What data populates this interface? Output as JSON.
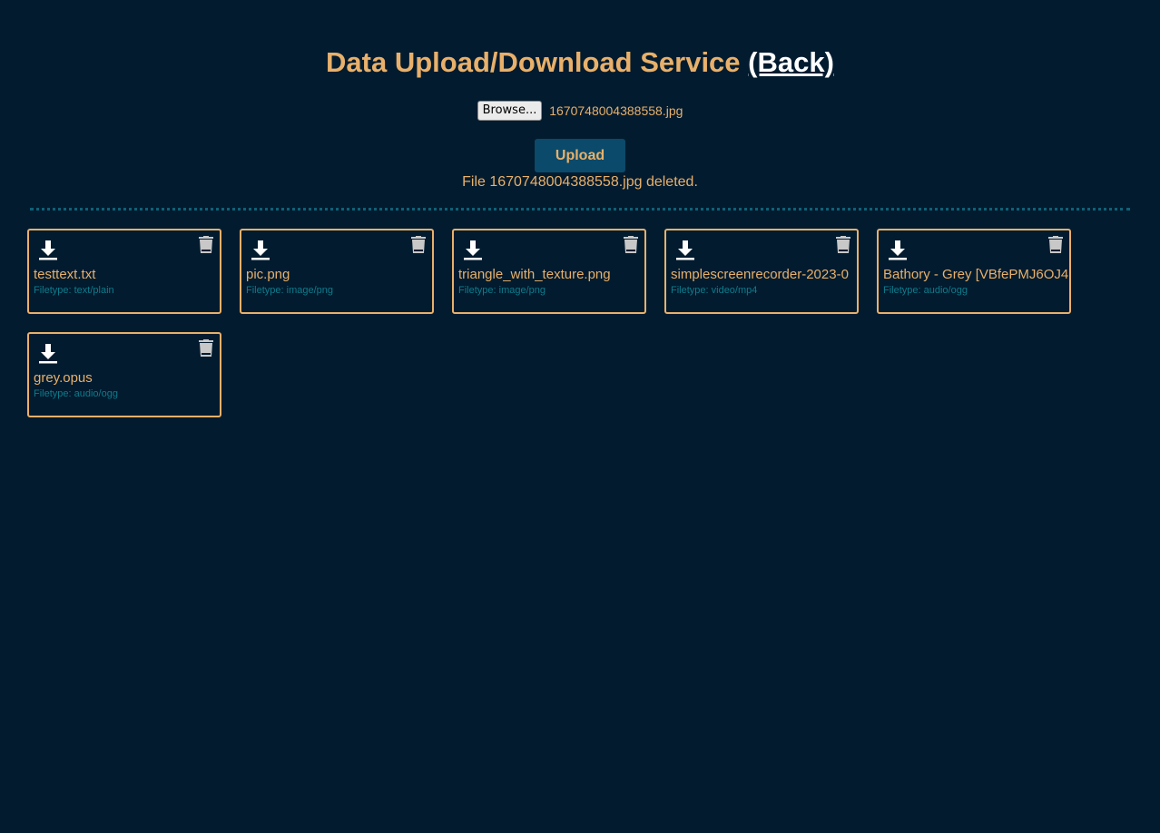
{
  "header": {
    "title": "Data Upload/Download Service",
    "back_link": "(Back)"
  },
  "upload": {
    "browse_label": "Browse...",
    "selected_file": "1670748004388558.jpg",
    "upload_label": "Upload",
    "status": "File 1670748004388558.jpg deleted."
  },
  "files": [
    {
      "name": "testtext.txt",
      "type": "Filetype: text/plain"
    },
    {
      "name": "pic.png",
      "type": "Filetype: image/png"
    },
    {
      "name": "triangle_with_texture.png",
      "type": "Filetype: image/png"
    },
    {
      "name": "simplescreenrecorder-2023-0",
      "type": "Filetype: video/mp4"
    },
    {
      "name": "Bathory - Grey [VBfePMJ6OJ4",
      "type": "Filetype: audio/ogg"
    },
    {
      "name": "grey.opus",
      "type": "Filetype: audio/ogg"
    }
  ],
  "icons": {
    "download": "download-icon",
    "delete": "trash-icon"
  },
  "colors": {
    "background": "#021b2f",
    "accent": "#e8b06a",
    "filetype": "#0e7c8c",
    "button": "#0b4a6a",
    "divider": "#0e6177"
  }
}
